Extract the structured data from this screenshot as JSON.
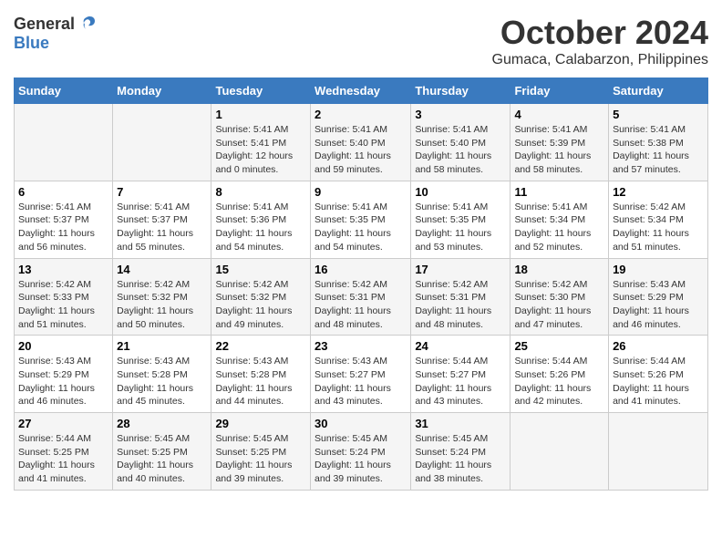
{
  "logo": {
    "general": "General",
    "blue": "Blue"
  },
  "title": "October 2024",
  "subtitle": "Gumaca, Calabarzon, Philippines",
  "days_of_week": [
    "Sunday",
    "Monday",
    "Tuesday",
    "Wednesday",
    "Thursday",
    "Friday",
    "Saturday"
  ],
  "weeks": [
    [
      {
        "day": "",
        "info": ""
      },
      {
        "day": "",
        "info": ""
      },
      {
        "day": "1",
        "info": "Sunrise: 5:41 AM\nSunset: 5:41 PM\nDaylight: 12 hours\nand 0 minutes."
      },
      {
        "day": "2",
        "info": "Sunrise: 5:41 AM\nSunset: 5:40 PM\nDaylight: 11 hours\nand 59 minutes."
      },
      {
        "day": "3",
        "info": "Sunrise: 5:41 AM\nSunset: 5:40 PM\nDaylight: 11 hours\nand 58 minutes."
      },
      {
        "day": "4",
        "info": "Sunrise: 5:41 AM\nSunset: 5:39 PM\nDaylight: 11 hours\nand 58 minutes."
      },
      {
        "day": "5",
        "info": "Sunrise: 5:41 AM\nSunset: 5:38 PM\nDaylight: 11 hours\nand 57 minutes."
      }
    ],
    [
      {
        "day": "6",
        "info": "Sunrise: 5:41 AM\nSunset: 5:37 PM\nDaylight: 11 hours\nand 56 minutes."
      },
      {
        "day": "7",
        "info": "Sunrise: 5:41 AM\nSunset: 5:37 PM\nDaylight: 11 hours\nand 55 minutes."
      },
      {
        "day": "8",
        "info": "Sunrise: 5:41 AM\nSunset: 5:36 PM\nDaylight: 11 hours\nand 54 minutes."
      },
      {
        "day": "9",
        "info": "Sunrise: 5:41 AM\nSunset: 5:35 PM\nDaylight: 11 hours\nand 54 minutes."
      },
      {
        "day": "10",
        "info": "Sunrise: 5:41 AM\nSunset: 5:35 PM\nDaylight: 11 hours\nand 53 minutes."
      },
      {
        "day": "11",
        "info": "Sunrise: 5:41 AM\nSunset: 5:34 PM\nDaylight: 11 hours\nand 52 minutes."
      },
      {
        "day": "12",
        "info": "Sunrise: 5:42 AM\nSunset: 5:34 PM\nDaylight: 11 hours\nand 51 minutes."
      }
    ],
    [
      {
        "day": "13",
        "info": "Sunrise: 5:42 AM\nSunset: 5:33 PM\nDaylight: 11 hours\nand 51 minutes."
      },
      {
        "day": "14",
        "info": "Sunrise: 5:42 AM\nSunset: 5:32 PM\nDaylight: 11 hours\nand 50 minutes."
      },
      {
        "day": "15",
        "info": "Sunrise: 5:42 AM\nSunset: 5:32 PM\nDaylight: 11 hours\nand 49 minutes."
      },
      {
        "day": "16",
        "info": "Sunrise: 5:42 AM\nSunset: 5:31 PM\nDaylight: 11 hours\nand 48 minutes."
      },
      {
        "day": "17",
        "info": "Sunrise: 5:42 AM\nSunset: 5:31 PM\nDaylight: 11 hours\nand 48 minutes."
      },
      {
        "day": "18",
        "info": "Sunrise: 5:42 AM\nSunset: 5:30 PM\nDaylight: 11 hours\nand 47 minutes."
      },
      {
        "day": "19",
        "info": "Sunrise: 5:43 AM\nSunset: 5:29 PM\nDaylight: 11 hours\nand 46 minutes."
      }
    ],
    [
      {
        "day": "20",
        "info": "Sunrise: 5:43 AM\nSunset: 5:29 PM\nDaylight: 11 hours\nand 46 minutes."
      },
      {
        "day": "21",
        "info": "Sunrise: 5:43 AM\nSunset: 5:28 PM\nDaylight: 11 hours\nand 45 minutes."
      },
      {
        "day": "22",
        "info": "Sunrise: 5:43 AM\nSunset: 5:28 PM\nDaylight: 11 hours\nand 44 minutes."
      },
      {
        "day": "23",
        "info": "Sunrise: 5:43 AM\nSunset: 5:27 PM\nDaylight: 11 hours\nand 43 minutes."
      },
      {
        "day": "24",
        "info": "Sunrise: 5:44 AM\nSunset: 5:27 PM\nDaylight: 11 hours\nand 43 minutes."
      },
      {
        "day": "25",
        "info": "Sunrise: 5:44 AM\nSunset: 5:26 PM\nDaylight: 11 hours\nand 42 minutes."
      },
      {
        "day": "26",
        "info": "Sunrise: 5:44 AM\nSunset: 5:26 PM\nDaylight: 11 hours\nand 41 minutes."
      }
    ],
    [
      {
        "day": "27",
        "info": "Sunrise: 5:44 AM\nSunset: 5:25 PM\nDaylight: 11 hours\nand 41 minutes."
      },
      {
        "day": "28",
        "info": "Sunrise: 5:45 AM\nSunset: 5:25 PM\nDaylight: 11 hours\nand 40 minutes."
      },
      {
        "day": "29",
        "info": "Sunrise: 5:45 AM\nSunset: 5:25 PM\nDaylight: 11 hours\nand 39 minutes."
      },
      {
        "day": "30",
        "info": "Sunrise: 5:45 AM\nSunset: 5:24 PM\nDaylight: 11 hours\nand 39 minutes."
      },
      {
        "day": "31",
        "info": "Sunrise: 5:45 AM\nSunset: 5:24 PM\nDaylight: 11 hours\nand 38 minutes."
      },
      {
        "day": "",
        "info": ""
      },
      {
        "day": "",
        "info": ""
      }
    ]
  ]
}
